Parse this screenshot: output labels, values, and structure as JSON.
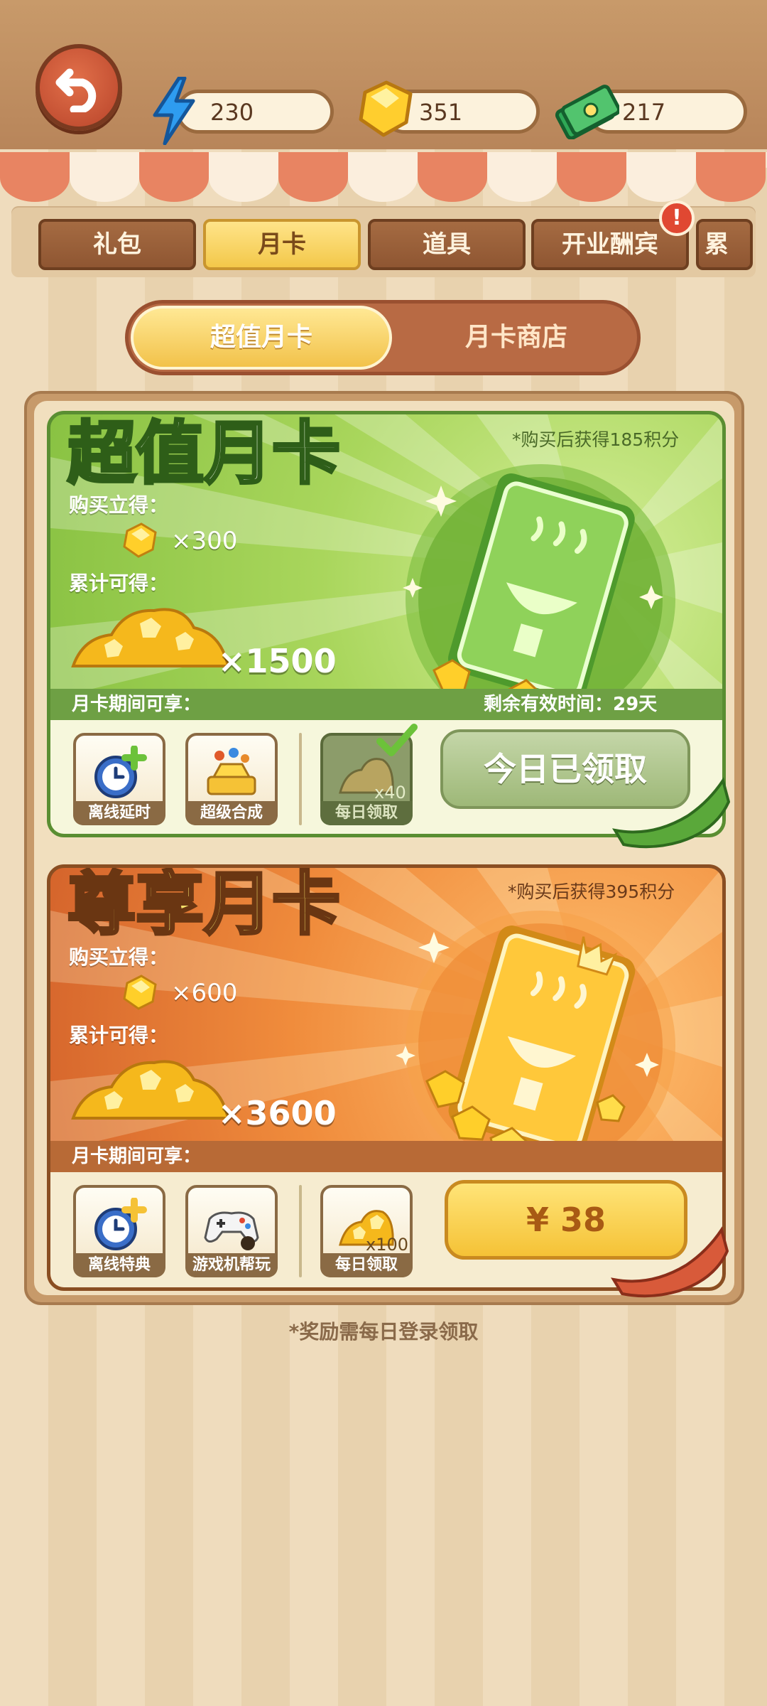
{
  "resources": {
    "energy": {
      "icon": "lightning-icon",
      "value": "230"
    },
    "diamond": {
      "icon": "diamond-icon",
      "value": "351"
    },
    "cash": {
      "icon": "cash-icon",
      "value": "217"
    }
  },
  "tabs": [
    {
      "label": "礼包",
      "active": false
    },
    {
      "label": "月卡",
      "active": true
    },
    {
      "label": "道具",
      "active": false
    },
    {
      "label": "开业酬宾",
      "active": false,
      "badge": "!"
    },
    {
      "label": "累",
      "active": false
    }
  ],
  "segments": {
    "left": "超值月卡",
    "right": "月卡商店"
  },
  "cards": {
    "value": {
      "title": "超值月卡",
      "points_note": "*购买后获得185积分",
      "instant_label": "购买立得：",
      "instant_qty": "×300",
      "total_label": "累计可得：",
      "total_qty": "×1500",
      "perks_label": "月卡期间可享：",
      "remaining": "剩余有效时间：29天",
      "perks": [
        "离线延时",
        "超级合成",
        "每日领取"
      ],
      "daily_qty": "x40",
      "action": "今日已领取"
    },
    "premium": {
      "title": "尊享月卡",
      "points_note": "*购买后获得395积分",
      "instant_label": "购买立得：",
      "instant_qty": "×600",
      "total_label": "累计可得：",
      "total_qty": "×3600",
      "perks_label": "月卡期间可享：",
      "perks": [
        "离线特典",
        "游戏机帮玩",
        "每日领取"
      ],
      "daily_qty": "x100",
      "price": "¥ 38"
    }
  },
  "footer_note": "*奖励需每日登录领取",
  "colors": {
    "green_card": "#86c040",
    "orange_card": "#d2602a",
    "gold": "#f5c236",
    "wood": "#b8855a"
  }
}
